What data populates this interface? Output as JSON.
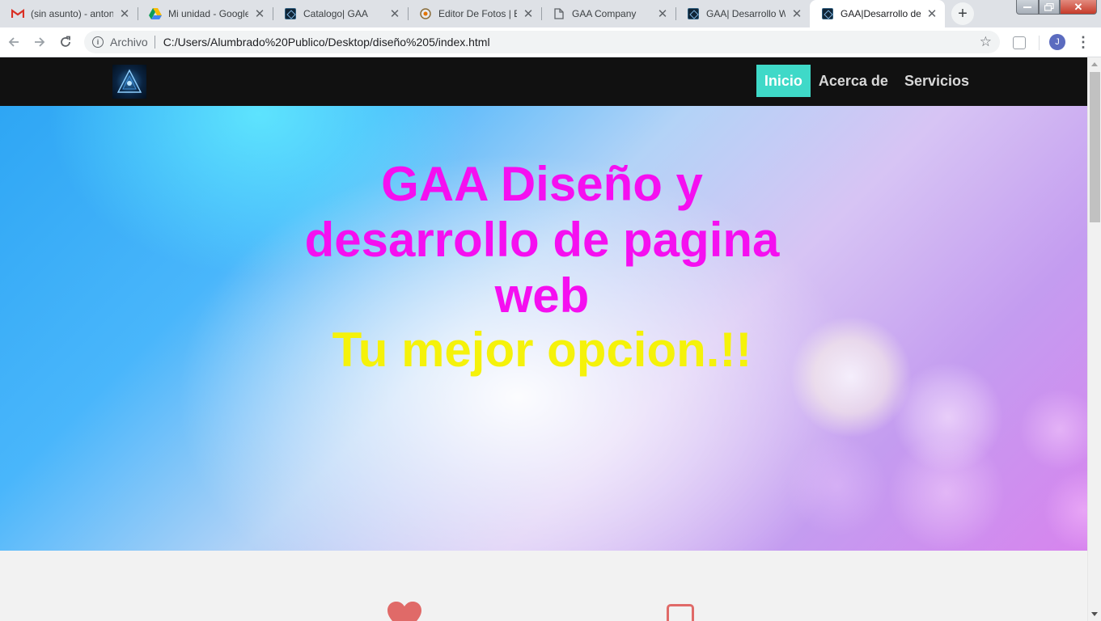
{
  "browser": {
    "tabs": [
      {
        "title": "(sin asunto) - antonio",
        "icon": "gmail-icon",
        "active": false
      },
      {
        "title": "Mi unidad - Google Drive",
        "icon": "drive-icon",
        "active": false
      },
      {
        "title": "Catalogo| GAA",
        "icon": "gaa-icon",
        "active": false
      },
      {
        "title": "Editor De Fotos | Be",
        "icon": "photo-editor-icon",
        "active": false
      },
      {
        "title": "GAA Company",
        "icon": "document-icon",
        "active": false
      },
      {
        "title": "GAA| Desarrollo Web",
        "icon": "gaa-icon",
        "active": false
      },
      {
        "title": "GAA|Desarrollo de",
        "icon": "gaa-icon",
        "active": true
      }
    ],
    "address_bar": {
      "scheme_label": "Archivo",
      "url": "C:/Users/Alumbrado%20Publico/Desktop/diseño%205/index.html"
    },
    "profile_initial": "J"
  },
  "site": {
    "nav": {
      "items": [
        {
          "label": "Inicio",
          "active": true
        },
        {
          "label": "Acerca de",
          "active": false
        },
        {
          "label": "Servicios",
          "active": false
        }
      ]
    },
    "hero": {
      "title_lines": [
        "GAA Diseño y",
        "desarrollo de pagina",
        "web"
      ],
      "subtitle": "Tu mejor opcion.!!"
    },
    "feature_icons": [
      "heart-icon",
      "square-icon"
    ]
  },
  "colors": {
    "nav_active_bg": "#3fd9c8",
    "hero_title": "#f50ff0",
    "hero_subtitle": "#f5f20a",
    "feature_icon": "#e06a68"
  }
}
